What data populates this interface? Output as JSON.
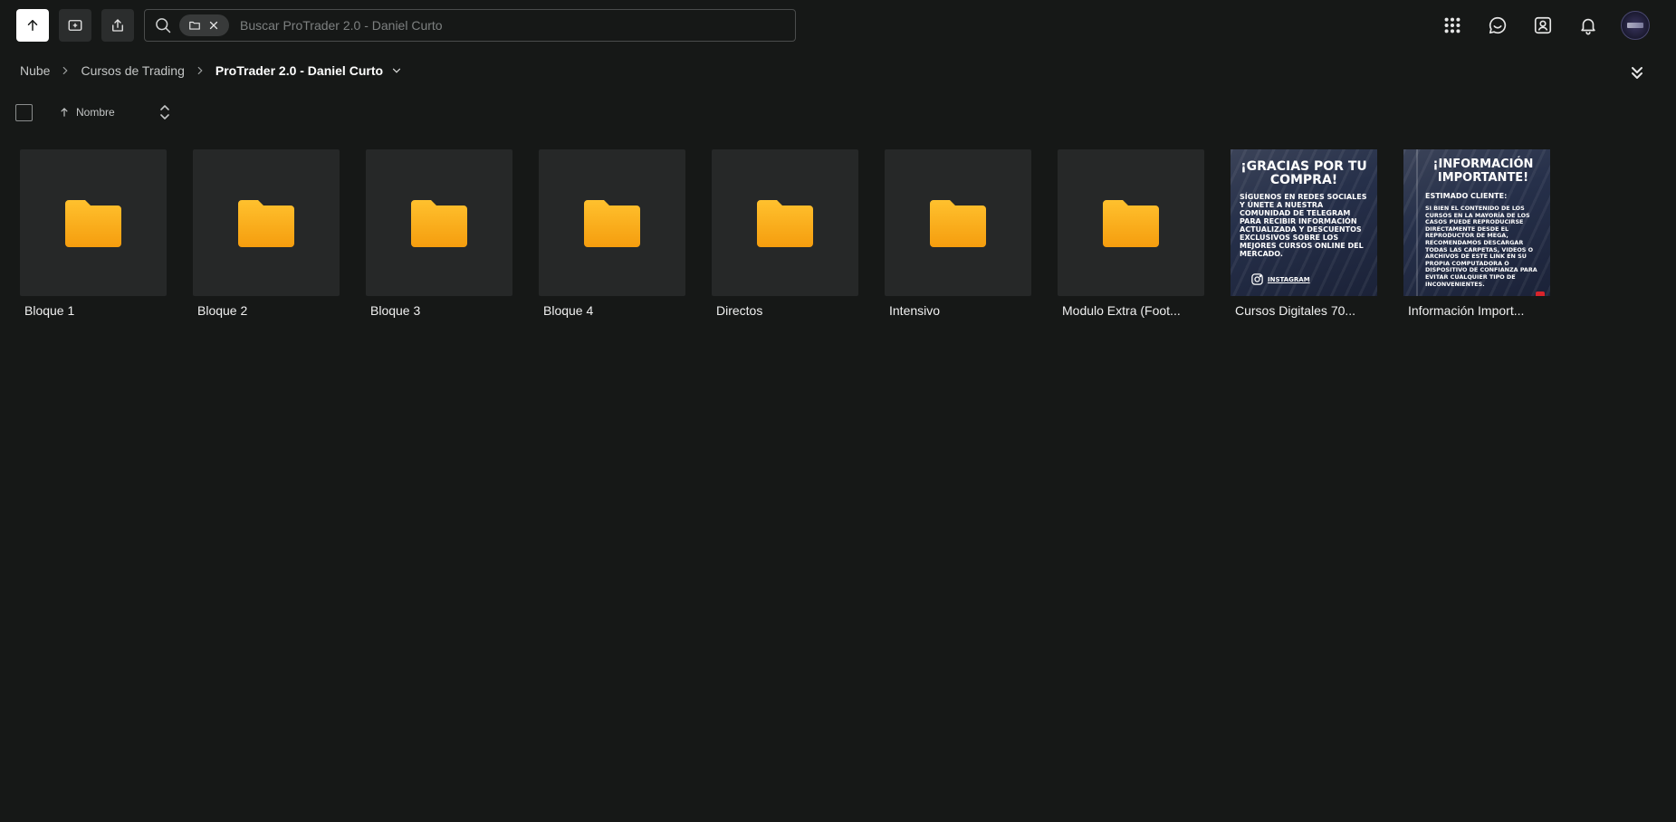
{
  "search": {
    "placeholder": "Buscar ProTrader 2.0 - Daniel Curto"
  },
  "breadcrumb": [
    {
      "label": "Nube"
    },
    {
      "label": "Cursos de Trading"
    },
    {
      "label": "ProTrader 2.0 - Daniel Curto"
    }
  ],
  "sort": {
    "label": "Nombre",
    "direction": "ascending"
  },
  "colors": {
    "background": "#161817",
    "tile": "#262828",
    "folder": "#ffb31c",
    "folder_dark": "#f29a0c"
  },
  "items": [
    {
      "name": "Bloque 1",
      "type": "folder"
    },
    {
      "name": "Bloque 2",
      "type": "folder"
    },
    {
      "name": "Bloque 3",
      "type": "folder"
    },
    {
      "name": "Bloque 4",
      "type": "folder"
    },
    {
      "name": "Directos",
      "type": "folder"
    },
    {
      "name": "Intensivo",
      "type": "folder"
    },
    {
      "name": "Modulo Extra (Foot...",
      "type": "folder"
    },
    {
      "name": "Cursos Digitales 70...",
      "type": "image",
      "thumb": {
        "heading": "¡GRACIAS POR TU COMPRA!",
        "body": "SÍGUENOS EN REDES SOCIALES Y ÚNETE A NUESTRA COMUNIDAD DE TELEGRAM PARA RECIBIR INFORMACIÓN ACTUALIZADA Y DESCUENTOS EXCLUSIVOS SOBRE LOS MEJORES CURSOS ONLINE DEL MERCADO.",
        "social": "INSTAGRAM"
      }
    },
    {
      "name": "Información Import...",
      "type": "image",
      "thumb": {
        "heading": "¡INFORMACIÓN IMPORTANTE!",
        "subheading": "ESTIMADO CLIENTE:",
        "body": "SI BIEN EL CONTENIDO DE LOS CURSOS EN LA MAYORÍA DE LOS CASOS PUEDE REPRODUCIRSE DIRECTAMENTE DESDE EL REPRODUCTOR DE MEGA, RECOMENDAMOS DESCARGAR TODAS LAS CARPETAS, VIDEOS O ARCHIVOS DE ESTE LINK EN SU PROPIA COMPUTADORA O DISPOSITIVO DE CONFIANZA PARA EVITAR CUALQUIER TIPO DE INCONVENIENTES."
      }
    }
  ]
}
